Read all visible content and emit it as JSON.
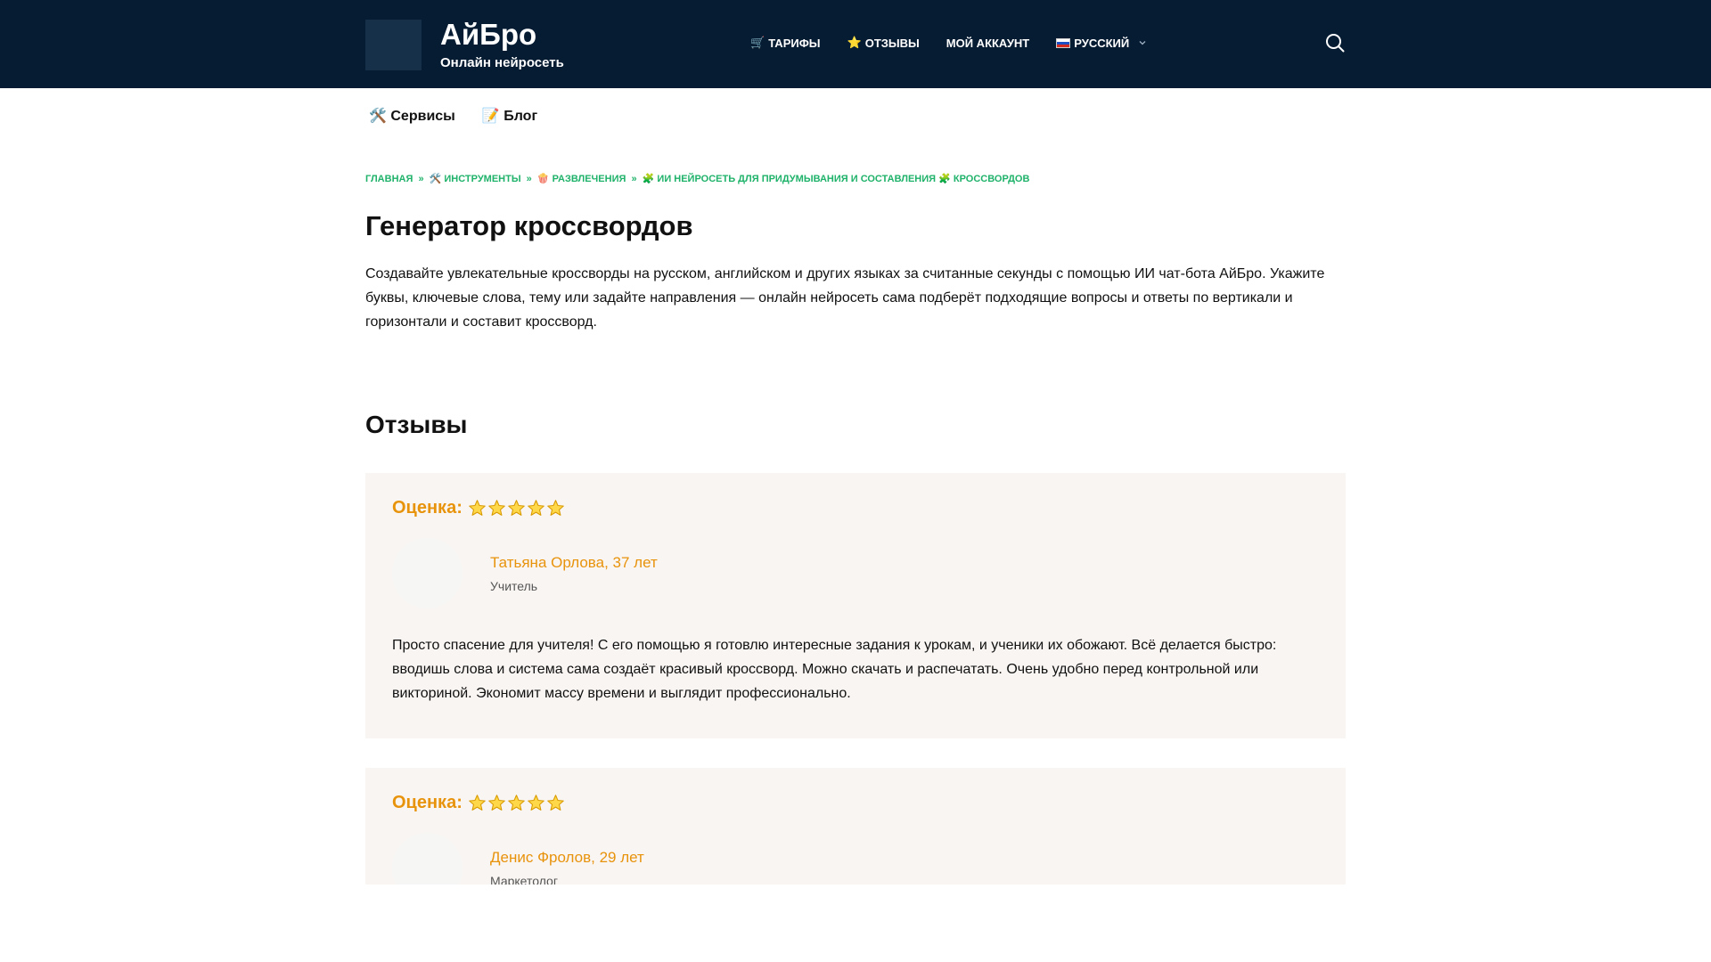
{
  "header": {
    "brand_title": "АйБро",
    "brand_subtitle": "Онлайн нейросеть",
    "nav": [
      {
        "icon": "🛒",
        "label": "ТАРИФЫ"
      },
      {
        "icon": "⭐",
        "label": "ОТЗЫВЫ"
      },
      {
        "icon": "",
        "label": "МОЙ АККАУНТ"
      },
      {
        "icon": "ru-flag",
        "label": "РУССКИЙ"
      }
    ]
  },
  "subnav": [
    {
      "icon": "🛠️",
      "label": "Сервисы"
    },
    {
      "icon": "📝",
      "label": "Блог"
    }
  ],
  "breadcrumb": [
    {
      "icon": "",
      "label": "ГЛАВНАЯ"
    },
    {
      "icon": "🛠️",
      "label": "ИНСТРУМЕНТЫ"
    },
    {
      "icon": "🍿",
      "label": "РАЗВЛЕЧЕНИЯ"
    },
    {
      "icon": "🧩",
      "label": "ИИ НЕЙРОСЕТЬ ДЛЯ ПРИДУМЫВАНИЯ И СОСТАВЛЕНИЯ"
    },
    {
      "icon": "🧩",
      "label": "КРОССВОРДОВ"
    }
  ],
  "breadcrumb_separator": "»",
  "page": {
    "title": "Генератор кроссвордов",
    "intro": "Создавайте увлекательные кроссворды на русском, английском и других языках за считанные секунды с помощью ИИ чат-бота АйБро. Укажите буквы, ключевые слова, тему или задайте направления — онлайн нейросеть сама подберёт подходящие вопросы и ответы по вертикали и горизонтали и составит кроссворд."
  },
  "reviews_section": {
    "title": "Отзывы",
    "rating_label": "Оценка:",
    "items": [
      {
        "rating": 5,
        "author": "Татьяна Орлова, 37 лет",
        "role": "Учитель",
        "text": "Просто спасение для учителя! С его помощью я готовлю интересные задания к урокам, и ученики их обожают. Всё делается быстро: вводишь слова и система сама создаёт красивый кроссворд. Можно скачать и распечатать. Очень удобно перед контрольной или викториной. Экономит массу времени и выглядит профессионально."
      },
      {
        "rating": 5,
        "author": "Денис Фролов, 29 лет",
        "role": "Маркетолог",
        "text": ""
      }
    ]
  },
  "colors": {
    "header_bg": "#061c33",
    "breadcrumb": "#1fb26a",
    "accent": "#e8930c",
    "review_bg": "#f9f5f3"
  }
}
